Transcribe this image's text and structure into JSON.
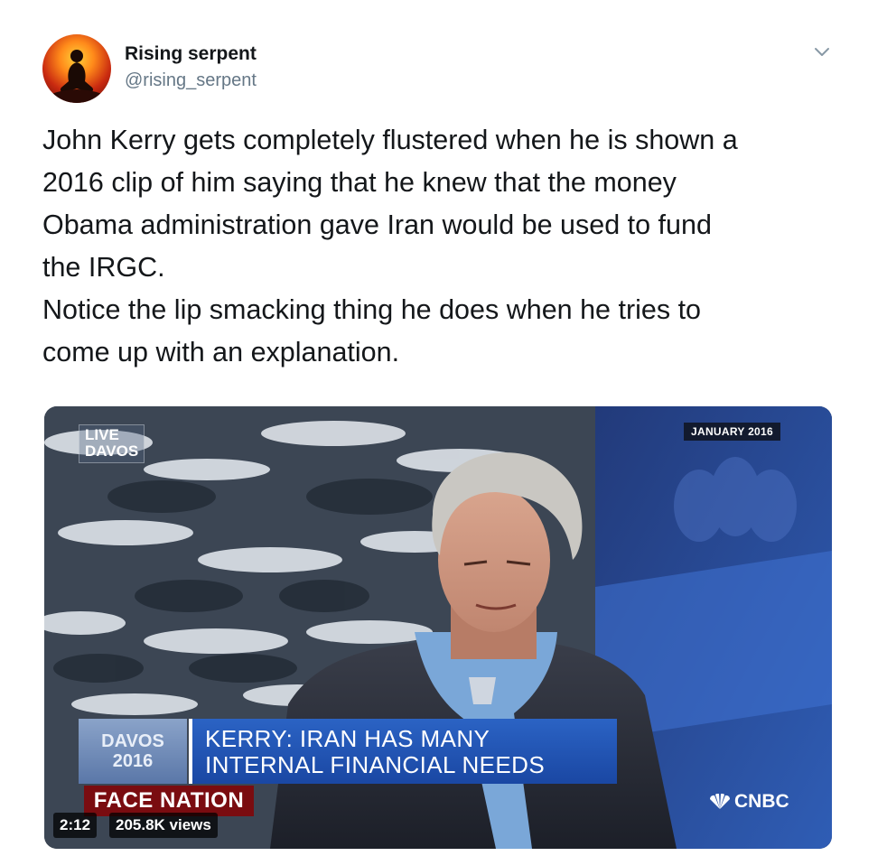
{
  "user": {
    "display_name": "Rising serpent",
    "handle": "@rising_serpent",
    "avatar_icon": "meditating-figure-avatar"
  },
  "tweet": {
    "text_lines": [
      "John Kerry gets completely flustered when he is shown a",
      "2016 clip of him saying that he knew that the money",
      "Obama administration gave Iran would be used to fund",
      "the IRGC.",
      "Notice the lip smacking thing he does when he tries to",
      "come up with an explanation."
    ]
  },
  "video": {
    "live_label_line1": "LIVE",
    "live_label_line2": "DAVOS",
    "date_badge": "JANUARY 2016",
    "davos_logo_line1": "DAVOS",
    "davos_logo_line2": "2016",
    "chyron_line1": "KERRY: IRAN HAS MANY",
    "chyron_line2": "INTERNAL FINANCIAL NEEDS",
    "show_name": "FACE NATION",
    "network": "CNBC",
    "duration": "2:12",
    "views": "205.8K views"
  },
  "colors": {
    "chyron_blue": "#1f52b3",
    "show_banner_red": "#7a0c10",
    "studio_blue": "#2f5db5",
    "handle_gray": "#657786"
  }
}
